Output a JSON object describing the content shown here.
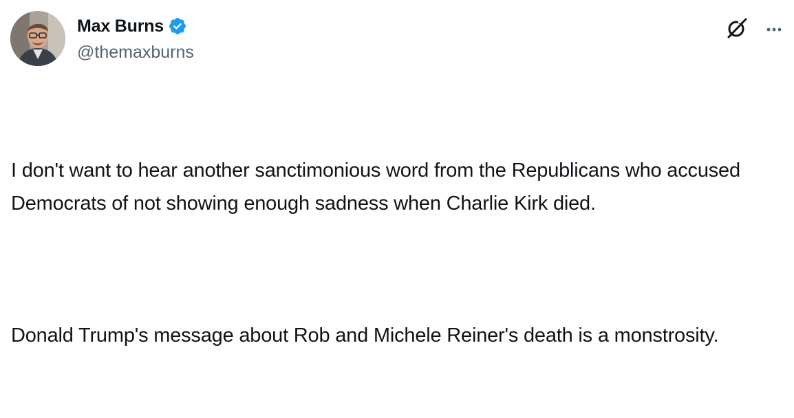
{
  "author": {
    "display_name": "Max Burns",
    "handle": "@themaxburns",
    "verified": true,
    "verified_color": "#1d9bf0"
  },
  "actions": {
    "grok_icon": "grok-icon",
    "more_icon": "more-dots-icon"
  },
  "tweet": {
    "paragraphs": [
      "I don't want to hear another sanctimonious word from the Republicans who accused Democrats of not showing enough sadness when Charlie Kirk died.",
      "Donald Trump's message about Rob and Michele Reiner's death is a monstrosity."
    ]
  }
}
